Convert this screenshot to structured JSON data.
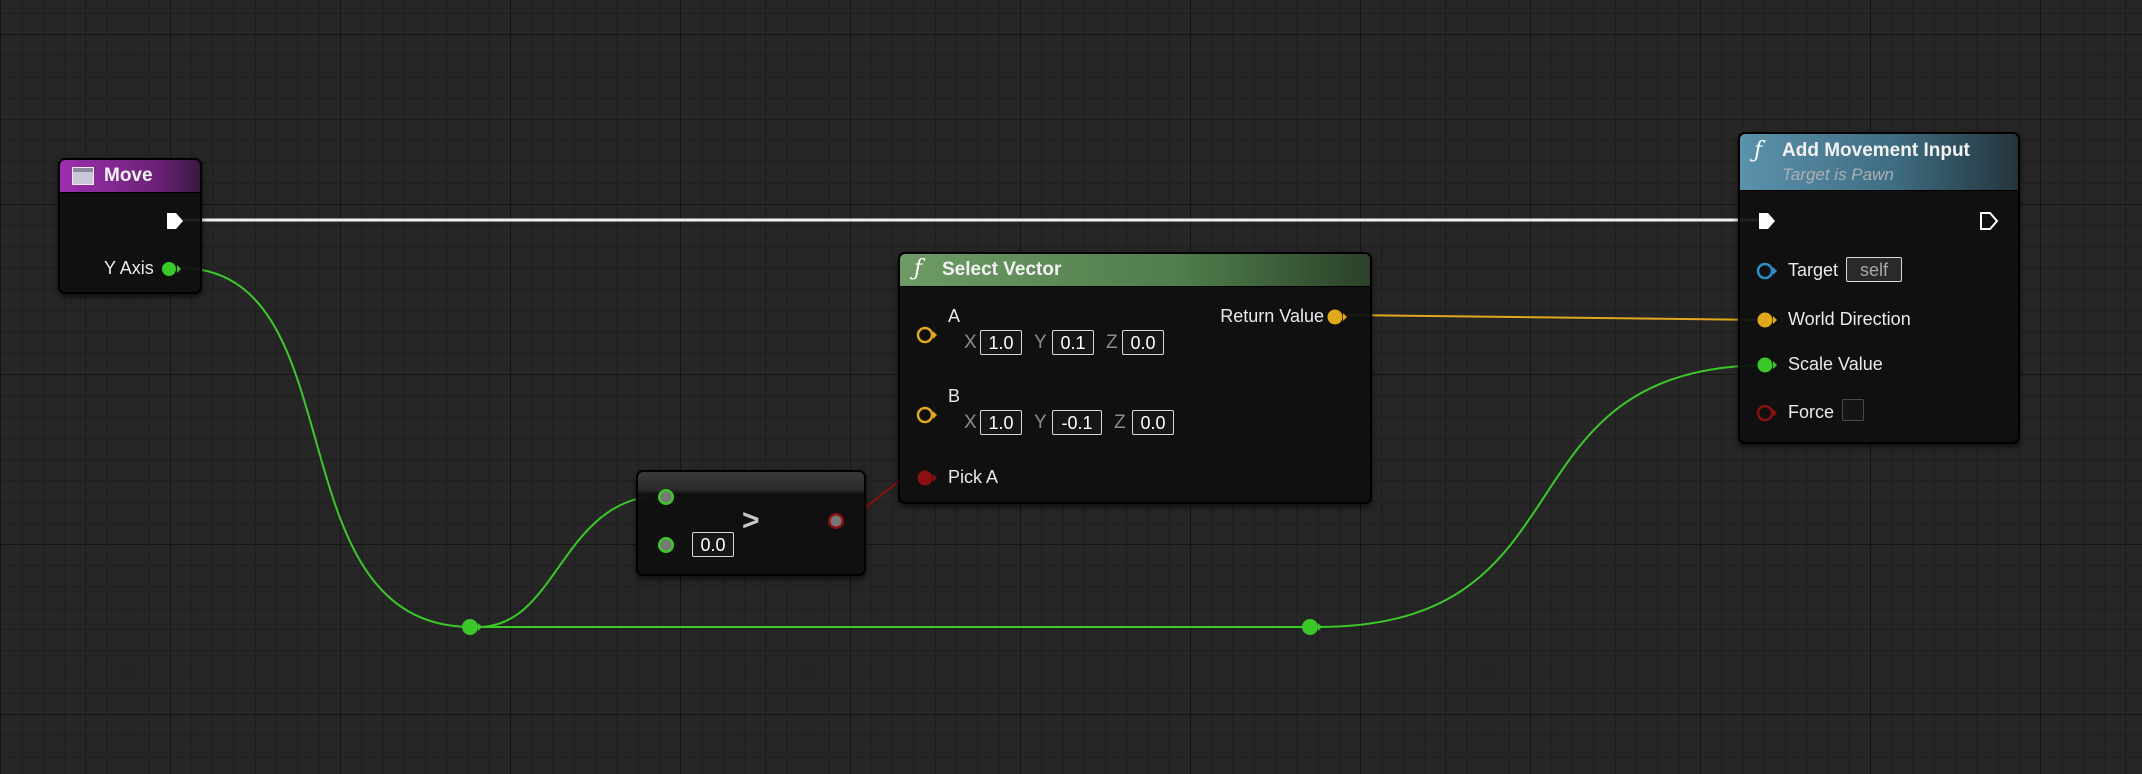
{
  "graph": {
    "background": "#262626",
    "wire_colors": {
      "exec": "#f0f0f0",
      "float": "#3cc82a",
      "vector": "#e2a81c",
      "bool": "#8b1010"
    }
  },
  "nodes": {
    "move": {
      "title": "Move",
      "header_color": "#8a2a9a",
      "outputs": {
        "y_axis_label": "Y Axis"
      }
    },
    "greater": {
      "operator": ">",
      "b_value": "0.0"
    },
    "select_vector": {
      "title": "Select Vector",
      "header_color": "#5a8a56",
      "pin_a": {
        "label": "A",
        "x_label": "X",
        "x": "1.0",
        "y_label": "Y",
        "y": "0.1",
        "z_label": "Z",
        "z": "0.0"
      },
      "pin_b": {
        "label": "B",
        "x_label": "X",
        "x": "1.0",
        "y_label": "Y",
        "y": "-0.1",
        "z_label": "Z",
        "z": "0.0"
      },
      "pick_a_label": "Pick A",
      "return_value_label": "Return Value"
    },
    "add_movement_input": {
      "title": "Add Movement Input",
      "subtitle": "Target is Pawn",
      "header_color": "#4a7e96",
      "target_label": "Target",
      "target_value": "self",
      "world_direction_label": "World Direction",
      "scale_value_label": "Scale Value",
      "force_label": "Force",
      "force_checked": false
    }
  }
}
